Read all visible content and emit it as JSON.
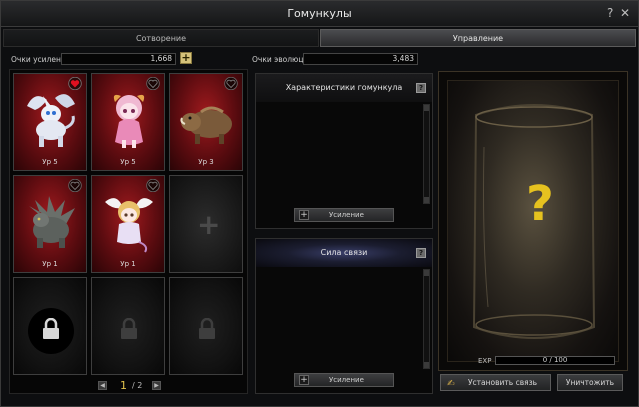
{
  "window": {
    "title": "Гомункулы",
    "help_glyph": "?",
    "close_glyph": "✕"
  },
  "tabs": [
    {
      "label": "Сотворение",
      "active": false
    },
    {
      "label": "Управление",
      "active": true
    }
  ],
  "points": {
    "boost_label": "Очки усиления",
    "boost_value": "1,668",
    "evolution_label": "Очки эволюции",
    "evolution_value": "3,483",
    "add_glyph": "+"
  },
  "slots": [
    {
      "state": "filled",
      "creature": "white-griffin-icon",
      "level": "Ур 5",
      "favorite": true
    },
    {
      "state": "filled",
      "creature": "pink-doll-icon",
      "level": "Ур 5",
      "favorite": false
    },
    {
      "state": "filled",
      "creature": "brown-boar-icon",
      "level": "Ур 3",
      "favorite": false
    },
    {
      "state": "filled",
      "creature": "stone-dragon-icon",
      "level": "Ур 1",
      "favorite": false
    },
    {
      "state": "filled",
      "creature": "winged-fairy-icon",
      "level": "Ур 1",
      "favorite": false
    },
    {
      "state": "empty",
      "glyph": "+"
    },
    {
      "state": "locked"
    },
    {
      "state": "locked"
    },
    {
      "state": "locked"
    }
  ],
  "pager": {
    "current": "1",
    "total": "/ 2"
  },
  "characteristics": {
    "title": "Характеристики гомункула",
    "help": "?",
    "button_label": "Усиление",
    "button_glyph": "+"
  },
  "bond": {
    "title": "Сила связи",
    "help": "?",
    "button_label": "Усиление",
    "button_glyph": "+"
  },
  "preview": {
    "placeholder": "?",
    "exp_label": "EXP",
    "exp_value": "0 / 100",
    "exp_fraction": 0
  },
  "actions": {
    "bond_button": "Установить связь",
    "destroy_button": "Уничтожить"
  },
  "colors": {
    "accent_gold": "#e6c21f",
    "slot_red": "#a01a1e",
    "favorite_heart": "#e01020"
  }
}
